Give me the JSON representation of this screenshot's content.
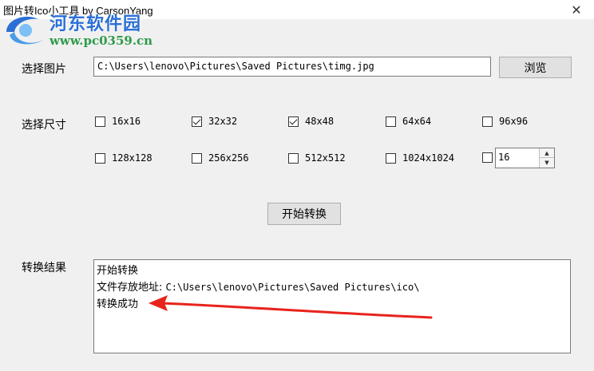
{
  "window": {
    "title": "图片转Ico小工具 by CarsonYang"
  },
  "watermark": {
    "name": "河东软件园",
    "url": "www.pc0359.cn"
  },
  "image_select": {
    "label": "选择图片",
    "path_value": "C:\\Users\\lenovo\\Pictures\\Saved Pictures\\timg.jpg",
    "browse_label": "浏览"
  },
  "size_select": {
    "label": "选择尺寸",
    "options": [
      {
        "label": "16x16",
        "checked": false
      },
      {
        "label": "32x32",
        "checked": true
      },
      {
        "label": "48x48",
        "checked": true
      },
      {
        "label": "64x64",
        "checked": false
      },
      {
        "label": "96x96",
        "checked": false
      },
      {
        "label": "128x128",
        "checked": false
      },
      {
        "label": "256x256",
        "checked": false
      },
      {
        "label": "512x512",
        "checked": false
      },
      {
        "label": "1024x1024",
        "checked": false
      }
    ],
    "custom": {
      "checked": false,
      "value": "16"
    }
  },
  "start_button": {
    "label": "开始转换"
  },
  "result": {
    "label": "转换结果",
    "lines": {
      "line1": "开始转换",
      "line2_prefix": "文件存放地址:",
      "line2_path": "C:\\Users\\lenovo\\Pictures\\Saved Pictures\\ico\\",
      "line3": "转换成功"
    }
  },
  "colors": {
    "watermark_blue": "#2a6fd6",
    "watermark_green": "#2e9a4a",
    "arrow_red": "#e8231c"
  },
  "icons": [
    "close-icon",
    "spin-up-icon",
    "spin-down-icon",
    "checkmark-icon",
    "arrow-annotation"
  ]
}
